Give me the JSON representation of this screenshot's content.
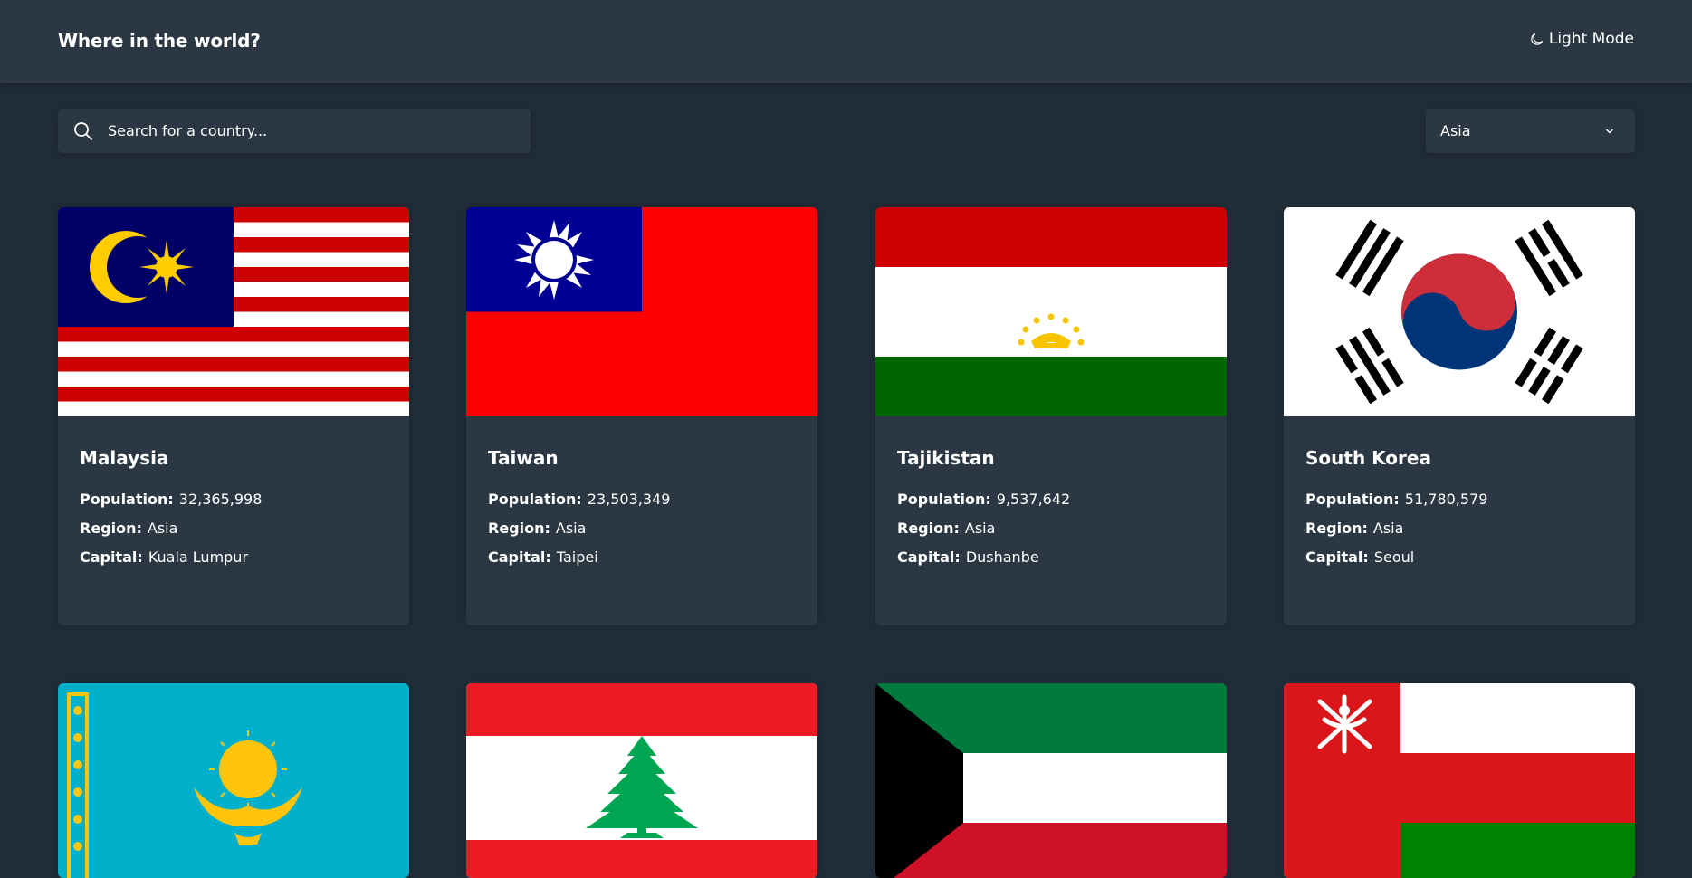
{
  "header": {
    "title": "Where in the world?",
    "mode_label": "Light Mode"
  },
  "search": {
    "placeholder": "Search for a country..."
  },
  "filter": {
    "selected": "Asia"
  },
  "labels": {
    "population": "Population:",
    "region": "Region:",
    "capital": "Capital:"
  },
  "countries": [
    {
      "name": "Malaysia",
      "population": "32,365,998",
      "region": "Asia",
      "capital": "Kuala Lumpur"
    },
    {
      "name": "Taiwan",
      "population": "23,503,349",
      "region": "Asia",
      "capital": "Taipei"
    },
    {
      "name": "Tajikistan",
      "population": "9,537,642",
      "region": "Asia",
      "capital": "Dushanbe"
    },
    {
      "name": "South Korea",
      "population": "51,780,579",
      "region": "Asia",
      "capital": "Seoul"
    },
    {
      "name": "",
      "population": "",
      "region": "",
      "capital": ""
    },
    {
      "name": "",
      "population": "",
      "region": "",
      "capital": ""
    },
    {
      "name": "",
      "population": "",
      "region": "",
      "capital": ""
    },
    {
      "name": "",
      "population": "",
      "region": "",
      "capital": ""
    }
  ],
  "flags": [
    "malaysia-flag",
    "taiwan-flag",
    "tajikistan-flag",
    "south-korea-flag",
    "kazakhstan-flag",
    "lebanon-flag",
    "kuwait-flag",
    "oman-flag"
  ],
  "colors": {
    "background": "#202c37",
    "surface": "#2b3844",
    "text": "#ffffff"
  }
}
